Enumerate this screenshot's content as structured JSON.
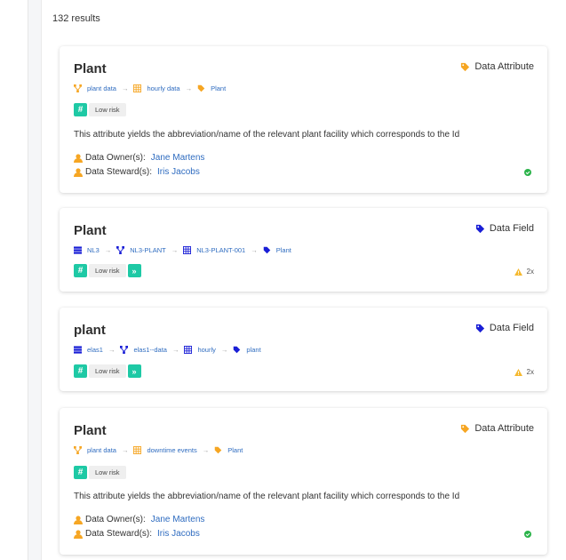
{
  "results_label": "132 results",
  "colors": {
    "accent_teal": "#1ec9a5",
    "attribute_orange": "#f6a623",
    "field_navy": "#1a1fd6",
    "link_blue": "#2f6cc0",
    "ok_green": "#2bb34a",
    "warn_yellow": "#f5b82e"
  },
  "cards": [
    {
      "title": "Plant",
      "type_label": "Data Attribute",
      "type_icon": "tag-icon",
      "crumbs": [
        "plant data",
        "hourly data",
        "Plant"
      ],
      "risk_label": "Low risk",
      "description": "This attribute yields the abbreviation/name of the relevant plant facility which corresponds to the Id",
      "owner_label": "Data Owner(s):",
      "owner_name": "Jane Martens",
      "steward_label": "Data Steward(s):",
      "steward_name": "Iris Jacobs"
    },
    {
      "title": "Plant",
      "type_label": "Data Field",
      "type_icon": "tag-icon",
      "crumbs": [
        "NL3",
        "NL3-PLANT",
        "NL3-PLANT-001",
        "Plant"
      ],
      "risk_label": "Low risk",
      "more_label": "»",
      "warn_count": "2x"
    },
    {
      "title": "plant",
      "type_label": "Data Field",
      "type_icon": "tag-icon",
      "crumbs": [
        "elas1",
        "elas1--data",
        "hourly",
        "plant"
      ],
      "risk_label": "Low risk",
      "more_label": "»",
      "warn_count": "2x"
    },
    {
      "title": "Plant",
      "type_label": "Data Attribute",
      "type_icon": "tag-icon",
      "crumbs": [
        "plant data",
        "downtime events",
        "Plant"
      ],
      "risk_label": "Low risk",
      "description": "This attribute yields the abbreviation/name of the relevant plant facility which corresponds to the Id",
      "owner_label": "Data Owner(s):",
      "owner_name": "Jane Martens",
      "steward_label": "Data Steward(s):",
      "steward_name": "Iris Jacobs"
    }
  ]
}
